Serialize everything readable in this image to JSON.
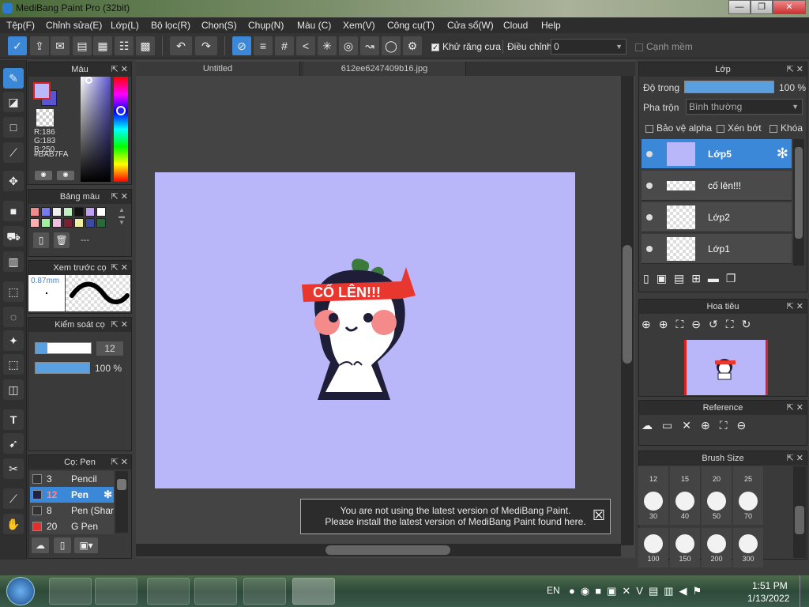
{
  "app": {
    "title": "MediBang Paint Pro (32bit)"
  },
  "window_controls": {
    "minimize": "—",
    "restore": "❐",
    "close": "✕"
  },
  "menu": [
    "Tệp(F)",
    "Chỉnh sửa(E)",
    "Lớp(L)",
    "Bộ lọc(R)",
    "Chọn(S)",
    "Chụp(N)",
    "Màu (C)",
    "Xem(V)",
    "Công cụ(T)",
    "Cửa sổ(W)",
    "Cloud",
    "Help"
  ],
  "toolbar": {
    "antialias_label": "Khử răng cưa",
    "correction_label": "Điều chỉnh",
    "correction_value": "0",
    "soft_edge_label": "Cạnh mềm"
  },
  "color_panel": {
    "title": "Màu",
    "r": "R:186",
    "g": "G:183",
    "b": "B:250",
    "hex": "#BAB7FA",
    "colors": {
      "foreground": "#bab7fa",
      "background": "#5a55d0"
    }
  },
  "palette_panel": {
    "title": "Bảng màu",
    "swatches": [
      "#f08c8c",
      "#7a7af0",
      "#f0f0f0",
      "#c0f0c0",
      "#111111",
      "#c0a0f0",
      "#ffffff",
      "#f8b0b0",
      "#a0f0a0",
      "#f0c0e0",
      "#7a2030",
      "#f0f0a0",
      "#3a4aa0",
      "#2a6a3a"
    ],
    "empty_label": "---"
  },
  "brush_preview": {
    "title": "Xem trước cọ",
    "size_label": "0.87mm"
  },
  "brush_control": {
    "title": "Kiểm soát cọ",
    "size": "12",
    "opacity": "100 %"
  },
  "brush_list": {
    "title": "Cọ: Pen",
    "items": [
      {
        "size": "3",
        "name": "Pencil",
        "color": "#333333"
      },
      {
        "size": "12",
        "name": "Pen",
        "color": "#222244"
      },
      {
        "size": "8",
        "name": "Pen (Shar",
        "color": "#333333"
      },
      {
        "size": "20",
        "name": "G Pen",
        "color": "#e03030"
      }
    ]
  },
  "tabs": [
    "Untitled",
    "612ee6247409b16.jpg"
  ],
  "artwork": {
    "banner_text": "CỐ LÊN!!!",
    "background": "#b9b6f9"
  },
  "notification": {
    "line1": "You are not using the latest version of MediBang Paint.",
    "line2": "Please install the latest version of MediBang Paint found here.",
    "close": "☒"
  },
  "layer_panel": {
    "title": "Lớp",
    "opacity_label": "Độ trong",
    "opacity_value": "100 %",
    "opacity_fraction": 1.0,
    "blend_label": "Pha trộn",
    "blend_value": "Bình thường",
    "protect_alpha": "Bảo vệ alpha",
    "clipping": "Xén bớt",
    "lock": "Khóa",
    "layers": [
      "Lớp5",
      "cố lên!!!",
      "Lớp2",
      "Lớp1"
    ]
  },
  "navigator": {
    "title": "Hoa tiêu"
  },
  "reference": {
    "title": "Reference"
  },
  "brush_size": {
    "title": "Brush Size",
    "top_row": [
      "12",
      "15",
      "20",
      "25"
    ],
    "row2": [
      "30",
      "40",
      "50",
      "70"
    ],
    "row3": [
      "100",
      "150",
      "200",
      "300"
    ]
  },
  "taskbar": {
    "language": "EN",
    "time": "1:51 PM",
    "date": "1/13/2022"
  }
}
